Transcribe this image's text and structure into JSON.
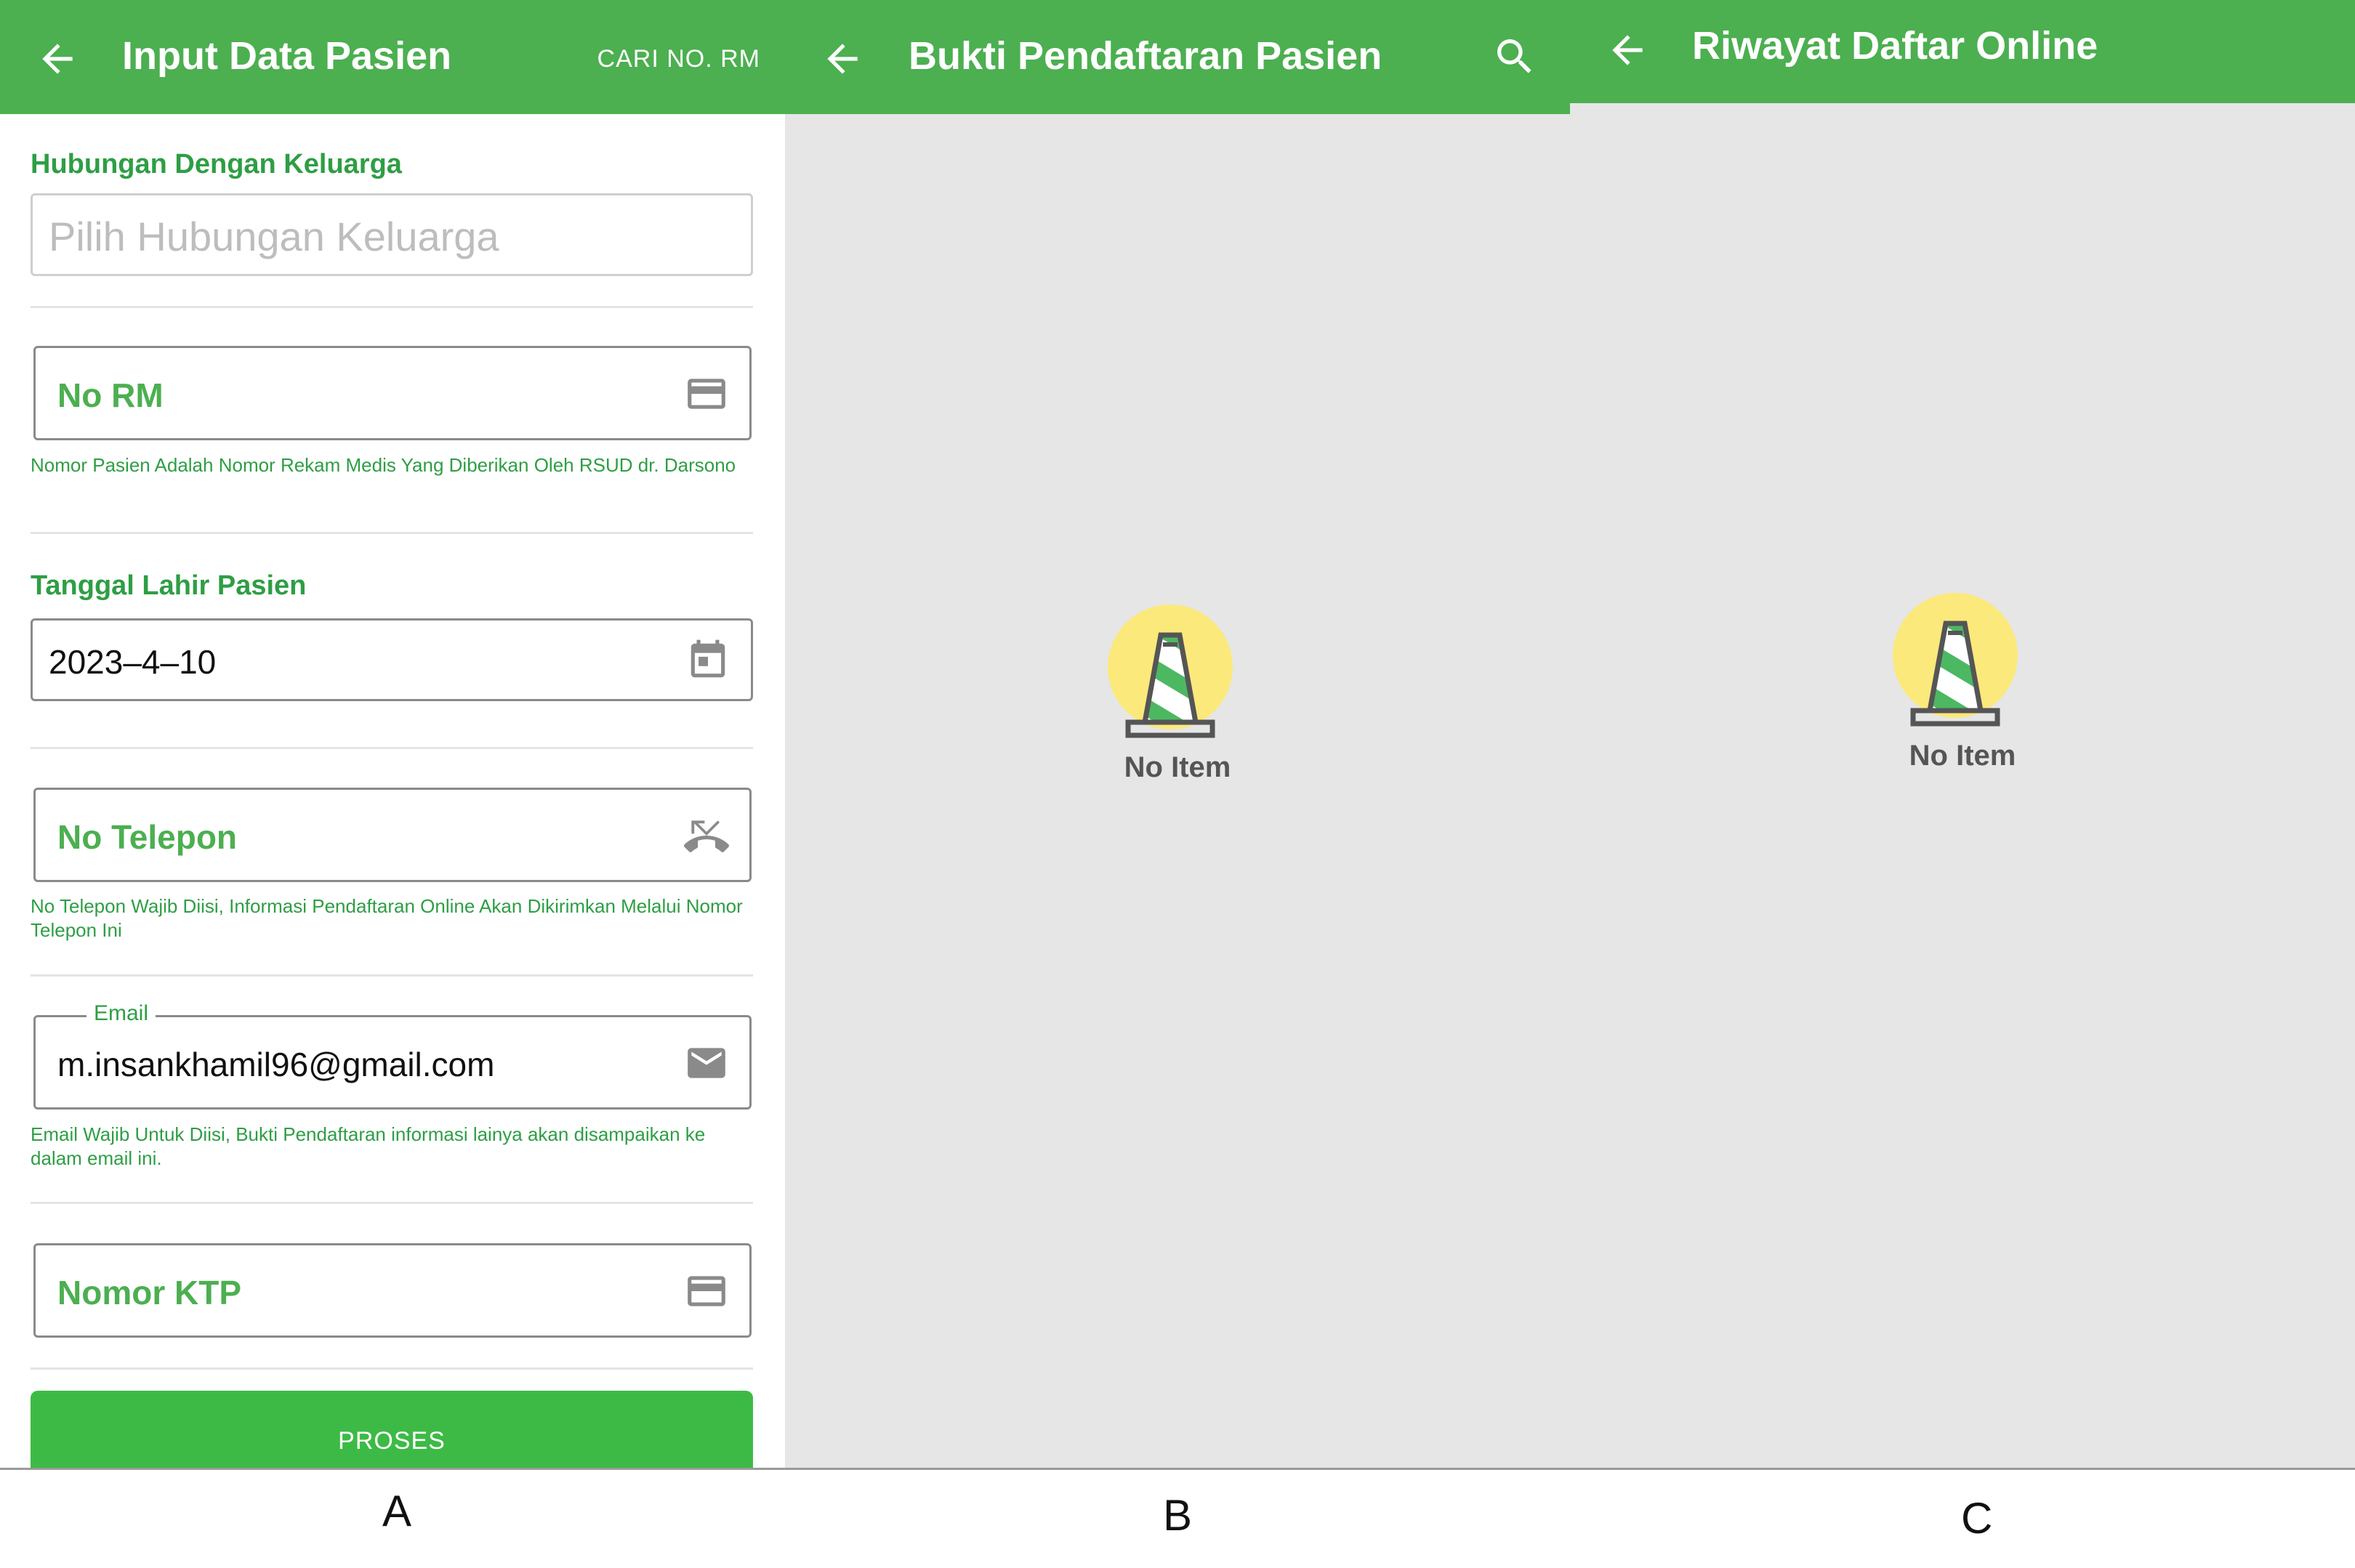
{
  "screen_a": {
    "title": "Input Data Pasien",
    "action": "CARI NO. RM",
    "hubungan": {
      "label": "Hubungan Dengan Keluarga",
      "placeholder": "Pilih Hubungan Keluarga"
    },
    "no_rm": {
      "placeholder": "No RM",
      "hint": "Nomor Pasien Adalah Nomor Rekam Medis Yang Diberikan Oleh  RSUD dr. Darsono",
      "icon": "card-icon"
    },
    "tanggal": {
      "label": "Tanggal Lahir Pasien",
      "value": "2023–4–10",
      "icon": "calendar-icon"
    },
    "telepon": {
      "placeholder": "No Telepon",
      "hint": "No Telepon Wajib Diisi, Informasi Pendaftaran Online Akan Dikirimkan Melalui Nomor Telepon Ini",
      "icon": "phone-missed-icon"
    },
    "email": {
      "label": "Email",
      "value": "m.insankhamil96@gmail.com",
      "hint": "Email Wajib Untuk Diisi, Bukti Pendaftaran informasi lainya akan disampaikan ke dalam email ini.",
      "icon": "mail-icon"
    },
    "ktp": {
      "placeholder": "Nomor KTP",
      "icon": "card-icon"
    },
    "submit": "PROSES"
  },
  "screen_b": {
    "title": "Bukti Pendaftaran Pasien",
    "empty_text": "No Item"
  },
  "screen_c": {
    "title": "Riwayat Daftar Online",
    "empty_text": "No Item"
  },
  "panel_labels": [
    "A",
    "B",
    "C"
  ],
  "colors": {
    "primary": "#4caf50",
    "button": "#3dba46",
    "accent_text": "#2e9e44",
    "empty_bg": "#e6e6e6",
    "cone_halo": "#fbe97b"
  }
}
